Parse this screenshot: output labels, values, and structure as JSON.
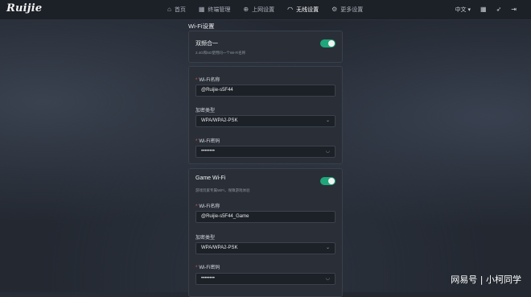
{
  "brand": "Ruijie",
  "nav": [
    {
      "label": "首页",
      "icon": "home-icon",
      "glyph": "⌂"
    },
    {
      "label": "终端管理",
      "icon": "devices-icon",
      "glyph": "▦"
    },
    {
      "label": "上网设置",
      "icon": "globe-icon",
      "glyph": "⊕"
    },
    {
      "label": "无线设置",
      "icon": "wifi-icon",
      "glyph": "◠"
    },
    {
      "label": "更多设置",
      "icon": "gear-icon",
      "glyph": "⚙"
    }
  ],
  "toolbar": {
    "language": "中文",
    "language_caret": "▾"
  },
  "section_title": "Wi-Fi设置",
  "dual_band": {
    "title": "双频合一",
    "desc": "2.4G和5G使用同一个Wi-Fi名称",
    "enabled": true
  },
  "main_wifi": {
    "name_label": "Wi-Fi名称",
    "name_value": "@Ruijie-s5F44",
    "enc_label": "加密类型",
    "enc_value": "WPA/WPA2-PSK",
    "pwd_label": "Wi-Fi密码",
    "pwd_value": "••••••••"
  },
  "game_wifi": {
    "title": "Game Wi-Fi",
    "desc": "游戏玩家专属WiFi，保障游戏体验",
    "enabled": true,
    "name_label": "Wi-Fi名称",
    "name_value": "@Ruijie-s5F44_Game",
    "enc_label": "加密类型",
    "enc_value": "WPA/WPA2-PSK",
    "pwd_label": "Wi-Fi密码",
    "pwd_value": "••••••••"
  },
  "required_mark": "*",
  "select_caret": "⌄",
  "eye_glyph": "◡",
  "watermark": "网易号 | 小柯同学",
  "colors": {
    "accent": "#1fa67a",
    "required": "#e25b5b"
  }
}
